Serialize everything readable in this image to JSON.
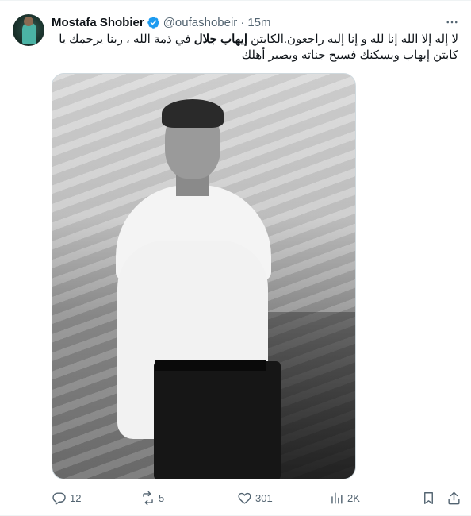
{
  "tweet": {
    "author": {
      "display_name": "Mostafa Shobier",
      "handle": "@oufashobeir",
      "verified": true,
      "avatar_icon": "avatar-image"
    },
    "separator": "·",
    "timestamp": "15m",
    "text": {
      "part1": "لا إله إلا الله إنا لله و إنا إليه راجعون.الكابتن ",
      "bold_name": "إيهاب جلال",
      "part2": " في ذمة الله ، ربنا يرحمك يا كابتن إيهاب ويسكنك فسيح جناته ويصبر أهلك"
    },
    "media": {
      "type": "photo",
      "style": "black-and-white"
    },
    "actions": {
      "reply_count": "12",
      "retweet_count": "5",
      "like_count": "301",
      "views_count": "2K"
    }
  },
  "colors": {
    "text_primary": "#0f1419",
    "text_secondary": "#536471",
    "verified_blue": "#1d9bf0",
    "border": "#cfd9de"
  }
}
